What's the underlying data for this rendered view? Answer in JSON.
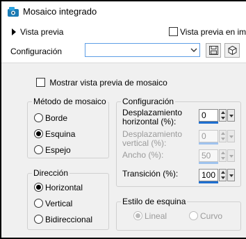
{
  "window": {
    "title": "Mosaico integrado"
  },
  "preview": {
    "label": "Vista previa",
    "live_label": "Vista previa en ima"
  },
  "config_bar": {
    "label": "Configuración",
    "value": ""
  },
  "mosaic_preview": {
    "label": "Mostrar vista previa de mosaico",
    "checked": false
  },
  "method_group": {
    "title": "Método de mosaico",
    "options": [
      {
        "label": "Borde",
        "selected": false
      },
      {
        "label": "Esquina",
        "selected": true
      },
      {
        "label": "Espejo",
        "selected": false
      }
    ]
  },
  "direction_group": {
    "title": "Dirección",
    "options": [
      {
        "label": "Horizontal",
        "selected": true
      },
      {
        "label": "Vertical",
        "selected": false
      },
      {
        "label": "Bidireccional",
        "selected": false
      }
    ]
  },
  "settings_group": {
    "title": "Configuración",
    "horizontal_offset": {
      "label_line1": "Desplazamiento",
      "label_line2": "horizontal (%):",
      "value": "0",
      "enabled": true
    },
    "vertical_offset": {
      "label_line1": "Desplazamiento",
      "label_line2": "vertical (%):",
      "value": "0",
      "enabled": false
    },
    "width": {
      "label": "Ancho (%):",
      "value": "50",
      "enabled": false
    },
    "transition": {
      "label": "Transición (%):",
      "value": "100",
      "enabled": true
    }
  },
  "corner_group": {
    "title": "Estilo de esquina",
    "options": [
      {
        "label": "Lineal",
        "selected": true,
        "enabled": false
      },
      {
        "label": "Curvo",
        "selected": false,
        "enabled": false
      }
    ]
  },
  "colors": {
    "accent": "#1e6fd0",
    "panel_bg": "#f0f0f0",
    "combo_border": "#5e9ee6"
  }
}
